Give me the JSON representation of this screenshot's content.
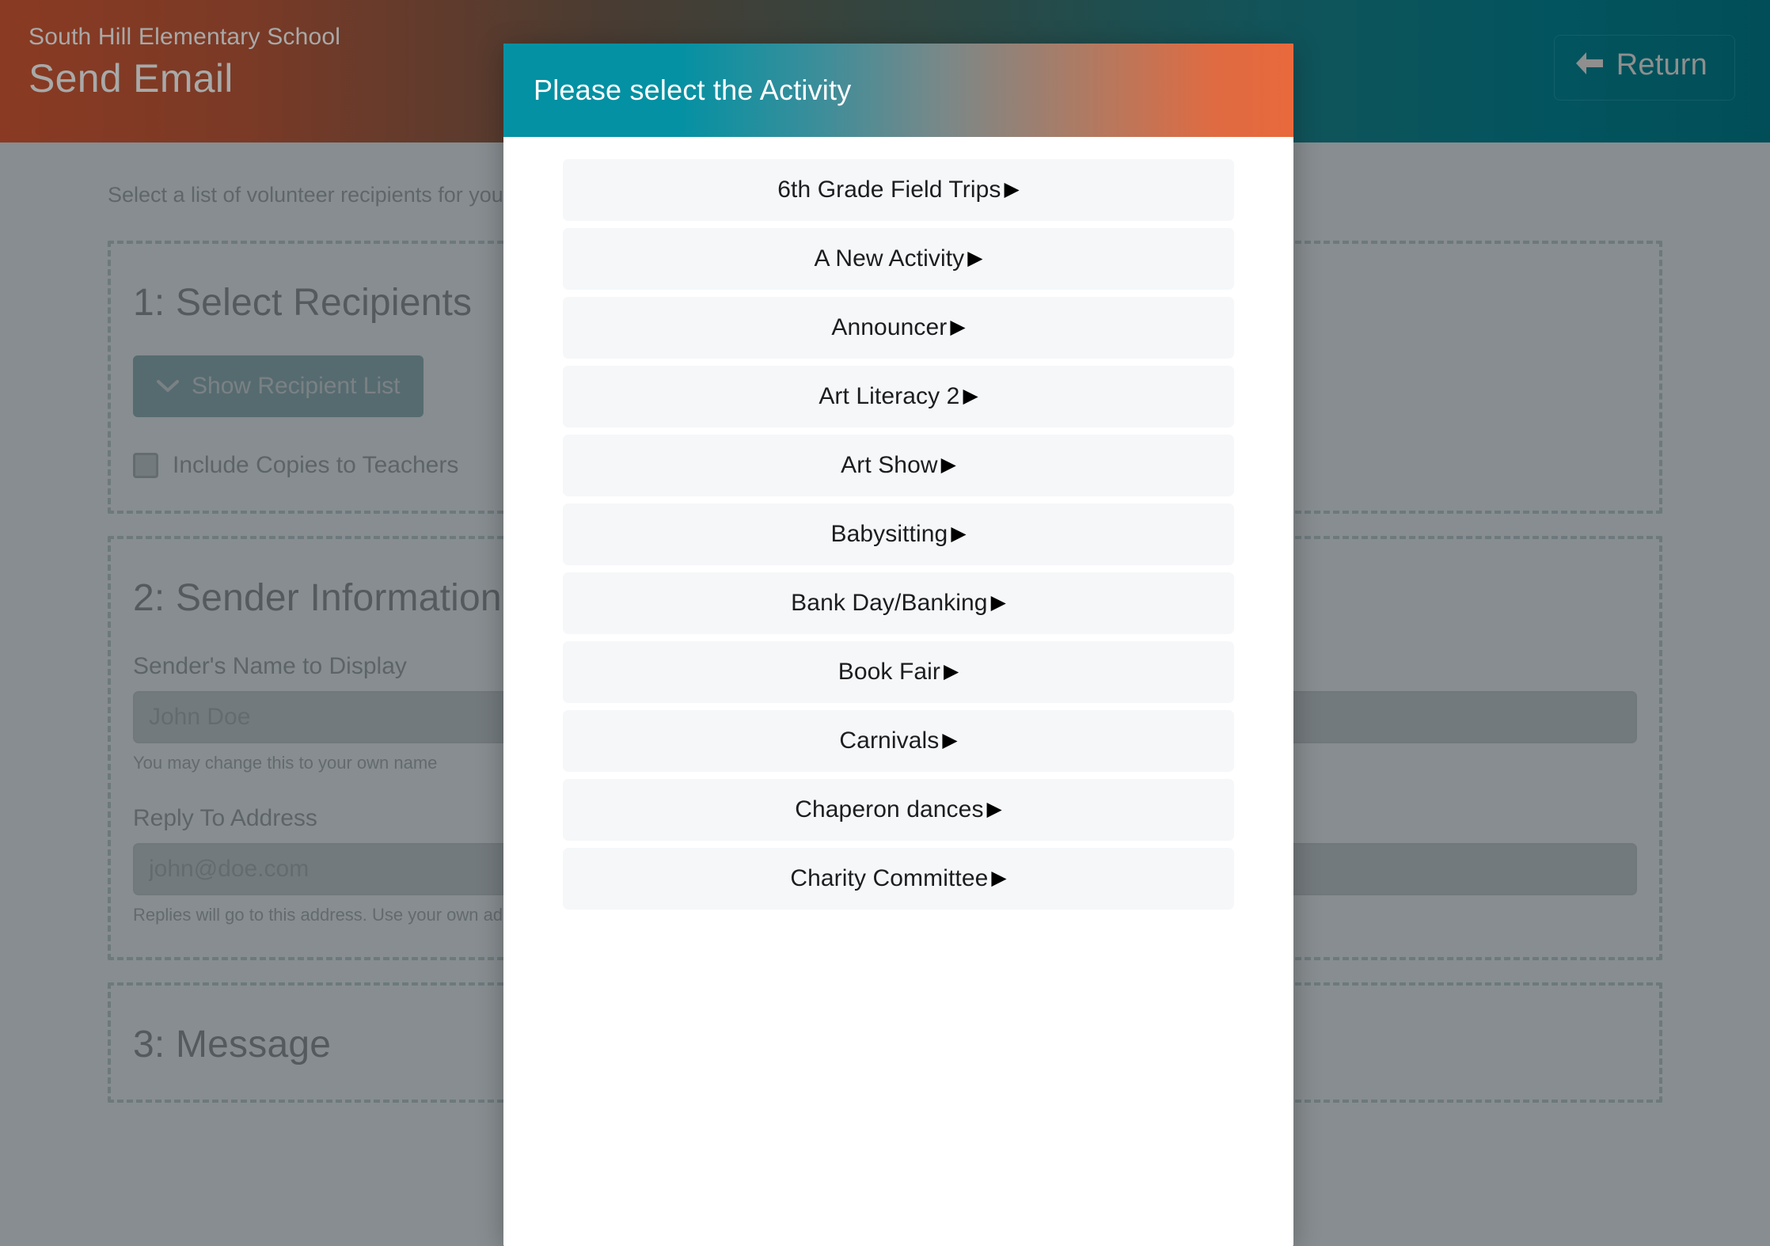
{
  "header": {
    "school_name": "South Hill Elementary School",
    "page_title": "Send Email",
    "return_label": "Return",
    "return_icon": "arrow-left-icon"
  },
  "page": {
    "intro_text": "Select a list of volunteer recipients for your email",
    "sections": [
      {
        "heading": "1: Select Recipients",
        "show_recipient_button": "Show Recipient List",
        "show_recipient_icon": "chevron-down-icon",
        "checkbox_label": "Include Copies to Teachers",
        "checkbox_checked": false
      },
      {
        "heading": "2: Sender Information",
        "fields": [
          {
            "label": "Sender's Name to Display",
            "value": "John Doe",
            "placeholder": "John Doe",
            "hint": "You may change this to your own name"
          },
          {
            "label": "Reply To Address",
            "value": "john@doe.com",
            "placeholder": "john@doe.com",
            "hint": "Replies will go to this address. Use your own address."
          }
        ]
      },
      {
        "heading": "3: Message"
      }
    ]
  },
  "modal": {
    "title": "Please select the Activity",
    "caret_icon": "caret-right-icon",
    "activities": [
      "6th Grade Field Trips",
      "A New Activity",
      "Announcer",
      "Art Literacy 2",
      "Art Show",
      "Babysitting",
      "Bank Day/Banking",
      "Book Fair",
      "Carnivals",
      "Chaperon dances",
      "Charity Committee"
    ]
  },
  "colors": {
    "modal_header_start": "#0391a3",
    "modal_header_end": "#e8693c",
    "page_header_start": "#8a3a22",
    "page_header_end": "#014e58",
    "accent_teal": "#0b5560",
    "dashed_border": "#7f9a99",
    "list_item_bg": "#f5f7f9",
    "scrim": "#697074"
  }
}
